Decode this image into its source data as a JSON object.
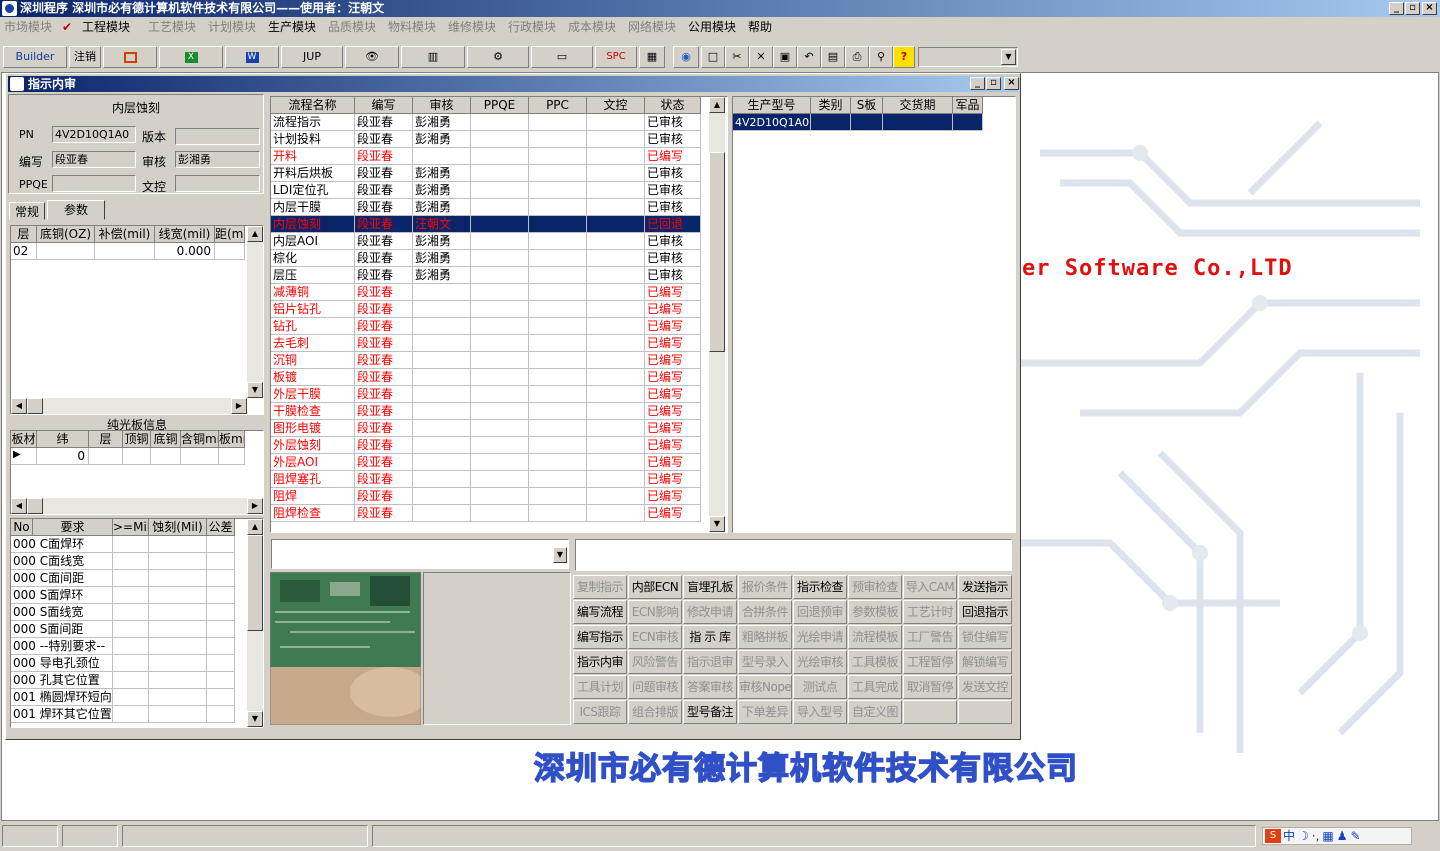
{
  "window": {
    "title": "深圳程序    深圳市必有德计算机软件技术有限公司——使用者：汪朝文"
  },
  "menu": [
    "市场模块",
    "工程模块",
    "工艺模块",
    "计划模块",
    "生产模块",
    "品质模块",
    "物料模块",
    "维修模块",
    "行政模块",
    "成本模块",
    "网络模块",
    "公用模块",
    "帮助"
  ],
  "toolbar": {
    "builder": "Builder",
    "logout": "注销",
    "jup": "JUP",
    "spc": "SPC"
  },
  "child": {
    "title": "指示内审"
  },
  "left": {
    "section_title": "内层蚀刻",
    "pn_label": "PN",
    "pn_value": "4V2D10Q1A0",
    "version_label": "版本",
    "version_value": "",
    "writer_label": "编写",
    "writer_value": "段亚春",
    "reviewer_label": "审核",
    "reviewer_value": "彭湘勇",
    "ppqe_label": "PPQE",
    "ppqe_value": "",
    "dc_label": "文控",
    "dc_value": "",
    "tabs": [
      "常规",
      "参数"
    ],
    "param_headers": [
      "层",
      "底铜(OZ)",
      "补偿(mil)",
      "线宽(mil)",
      "距(mi"
    ],
    "param_rows": [
      [
        "02",
        "",
        "",
        "0.000",
        ""
      ]
    ],
    "bare_title": "纯光板信息",
    "bare_headers": [
      "板材",
      "纬",
      "层",
      "顶铜",
      "底铜",
      "含铜mm",
      "板mm"
    ],
    "bare_rows": [
      [
        "",
        "0",
        "",
        "",
        "",
        "",
        ""
      ]
    ],
    "req_headers": [
      "No",
      "要求",
      ">=Mil",
      "蚀刻(Mil)",
      "公差"
    ],
    "req_rows": [
      [
        "000",
        "C面焊环"
      ],
      [
        "000",
        "C面线宽"
      ],
      [
        "000",
        "C面间距"
      ],
      [
        "000",
        "S面焊环"
      ],
      [
        "000",
        "S面线宽"
      ],
      [
        "000",
        "S面间距"
      ],
      [
        "000",
        "--特别要求--"
      ],
      [
        "000",
        "导电孔颈位"
      ],
      [
        "000",
        "孔其它位置"
      ],
      [
        "001",
        "椭圆焊环短向"
      ],
      [
        "001",
        "焊环其它位置"
      ]
    ]
  },
  "flow": {
    "headers": [
      "流程名称",
      "编写",
      "审核",
      "PPQE",
      "PPC",
      "文控",
      "状态"
    ],
    "rows": [
      {
        "name": "流程指示",
        "writer": "段亚春",
        "reviewer": "彭湘勇",
        "status": "已审核",
        "red": false,
        "sel": false
      },
      {
        "name": "计划投料",
        "writer": "段亚春",
        "reviewer": "彭湘勇",
        "status": "已审核",
        "red": false,
        "sel": false
      },
      {
        "name": "开料",
        "writer": "段亚春",
        "reviewer": "",
        "status": "已编写",
        "red": true,
        "sel": false
      },
      {
        "name": "开料后烘板",
        "writer": "段亚春",
        "reviewer": "彭湘勇",
        "status": "已审核",
        "red": false,
        "sel": false
      },
      {
        "name": "LDI定位孔",
        "writer": "段亚春",
        "reviewer": "彭湘勇",
        "status": "已审核",
        "red": false,
        "sel": false
      },
      {
        "name": "内层干膜",
        "writer": "段亚春",
        "reviewer": "彭湘勇",
        "status": "已审核",
        "red": false,
        "sel": false
      },
      {
        "name": "内层蚀刻",
        "writer": "段亚春",
        "reviewer": "汪朝文",
        "status": "已回退",
        "red": true,
        "sel": true
      },
      {
        "name": "内层AOI",
        "writer": "段亚春",
        "reviewer": "彭湘勇",
        "status": "已审核",
        "red": false,
        "sel": false
      },
      {
        "name": "棕化",
        "writer": "段亚春",
        "reviewer": "彭湘勇",
        "status": "已审核",
        "red": false,
        "sel": false
      },
      {
        "name": "层压",
        "writer": "段亚春",
        "reviewer": "彭湘勇",
        "status": "已审核",
        "red": false,
        "sel": false
      },
      {
        "name": "减薄铜",
        "writer": "段亚春",
        "reviewer": "",
        "status": "已编写",
        "red": true,
        "sel": false
      },
      {
        "name": "铝片钻孔",
        "writer": "段亚春",
        "reviewer": "",
        "status": "已编写",
        "red": true,
        "sel": false
      },
      {
        "name": "钻孔",
        "writer": "段亚春",
        "reviewer": "",
        "status": "已编写",
        "red": true,
        "sel": false
      },
      {
        "name": "去毛刺",
        "writer": "段亚春",
        "reviewer": "",
        "status": "已编写",
        "red": true,
        "sel": false
      },
      {
        "name": "沉铜",
        "writer": "段亚春",
        "reviewer": "",
        "status": "已编写",
        "red": true,
        "sel": false
      },
      {
        "name": "板镀",
        "writer": "段亚春",
        "reviewer": "",
        "status": "已编写",
        "red": true,
        "sel": false
      },
      {
        "name": "外层干膜",
        "writer": "段亚春",
        "reviewer": "",
        "status": "已编写",
        "red": true,
        "sel": false
      },
      {
        "name": "干膜检查",
        "writer": "段亚春",
        "reviewer": "",
        "status": "已编写",
        "red": true,
        "sel": false
      },
      {
        "name": "图形电镀",
        "writer": "段亚春",
        "reviewer": "",
        "status": "已编写",
        "red": true,
        "sel": false
      },
      {
        "name": "外层蚀刻",
        "writer": "段亚春",
        "reviewer": "",
        "status": "已编写",
        "red": true,
        "sel": false
      },
      {
        "name": "外层AOI",
        "writer": "段亚春",
        "reviewer": "",
        "status": "已编写",
        "red": true,
        "sel": false
      },
      {
        "name": "阻焊塞孔",
        "writer": "段亚春",
        "reviewer": "",
        "status": "已编写",
        "red": true,
        "sel": false
      },
      {
        "name": "阻焊",
        "writer": "段亚春",
        "reviewer": "",
        "status": "已编写",
        "red": true,
        "sel": false
      },
      {
        "name": "阻焊检查",
        "writer": "段亚春",
        "reviewer": "",
        "status": "已编写",
        "red": true,
        "sel": false
      }
    ]
  },
  "model": {
    "headers": [
      "生产型号",
      "类别",
      "S板",
      "交货期",
      "军品"
    ],
    "rows": [
      [
        "4V2D10Q1A0",
        "",
        "",
        "",
        ""
      ]
    ]
  },
  "actions": [
    [
      {
        "t": "复制指示",
        "d": true
      },
      {
        "t": "内部ECN",
        "d": false
      },
      {
        "t": "盲埋孔板",
        "d": false
      },
      {
        "t": "报价条件",
        "d": true
      },
      {
        "t": "指示检查",
        "d": false
      },
      {
        "t": "预审检查",
        "d": true
      },
      {
        "t": "导入CAM",
        "d": true
      },
      {
        "t": "发送指示",
        "d": false
      }
    ],
    [
      {
        "t": "编写流程",
        "d": false
      },
      {
        "t": "ECN影响",
        "d": true
      },
      {
        "t": "修改申请",
        "d": true
      },
      {
        "t": "合拼条件",
        "d": true
      },
      {
        "t": "回退预审",
        "d": true
      },
      {
        "t": "参数模板",
        "d": true
      },
      {
        "t": "工艺计时",
        "d": true
      },
      {
        "t": "回退指示",
        "d": false
      }
    ],
    [
      {
        "t": "编写指示",
        "d": false
      },
      {
        "t": "ECN审核",
        "d": true
      },
      {
        "t": "指 示 库",
        "d": false
      },
      {
        "t": "粗略拼板",
        "d": true
      },
      {
        "t": "光绘申请",
        "d": true
      },
      {
        "t": "流程模板",
        "d": true
      },
      {
        "t": "工厂警告",
        "d": true
      },
      {
        "t": "锁住编写",
        "d": true
      }
    ],
    [
      {
        "t": "指示内审",
        "d": false
      },
      {
        "t": "风险警告",
        "d": true
      },
      {
        "t": "指示退审",
        "d": true
      },
      {
        "t": "型号录入",
        "d": true
      },
      {
        "t": "光绘审核",
        "d": true
      },
      {
        "t": "工具模板",
        "d": true
      },
      {
        "t": "工程暂停",
        "d": true
      },
      {
        "t": "解锁编写",
        "d": true
      }
    ],
    [
      {
        "t": "工具计划",
        "d": true
      },
      {
        "t": "问题审核",
        "d": true
      },
      {
        "t": "答案审核",
        "d": true
      },
      {
        "t": "审核Nope",
        "d": true
      },
      {
        "t": "测试点",
        "d": true
      },
      {
        "t": "工具完成",
        "d": true
      },
      {
        "t": "取消暂停",
        "d": true
      },
      {
        "t": "发送文控",
        "d": true
      }
    ],
    [
      {
        "t": "ICS跟踪",
        "d": true
      },
      {
        "t": "组合排版",
        "d": true
      },
      {
        "t": "型号备注",
        "d": false
      },
      {
        "t": "下单差异",
        "d": true
      },
      {
        "t": "导入型号",
        "d": true
      },
      {
        "t": "自定义图",
        "d": true
      },
      {
        "t": "",
        "d": true
      },
      {
        "t": "",
        "d": true
      }
    ]
  ],
  "background": {
    "english": "er Software Co.,LTD",
    "company": "深圳市必有德计算机软件技术有限公司"
  },
  "tray": {
    "ime": "中"
  }
}
